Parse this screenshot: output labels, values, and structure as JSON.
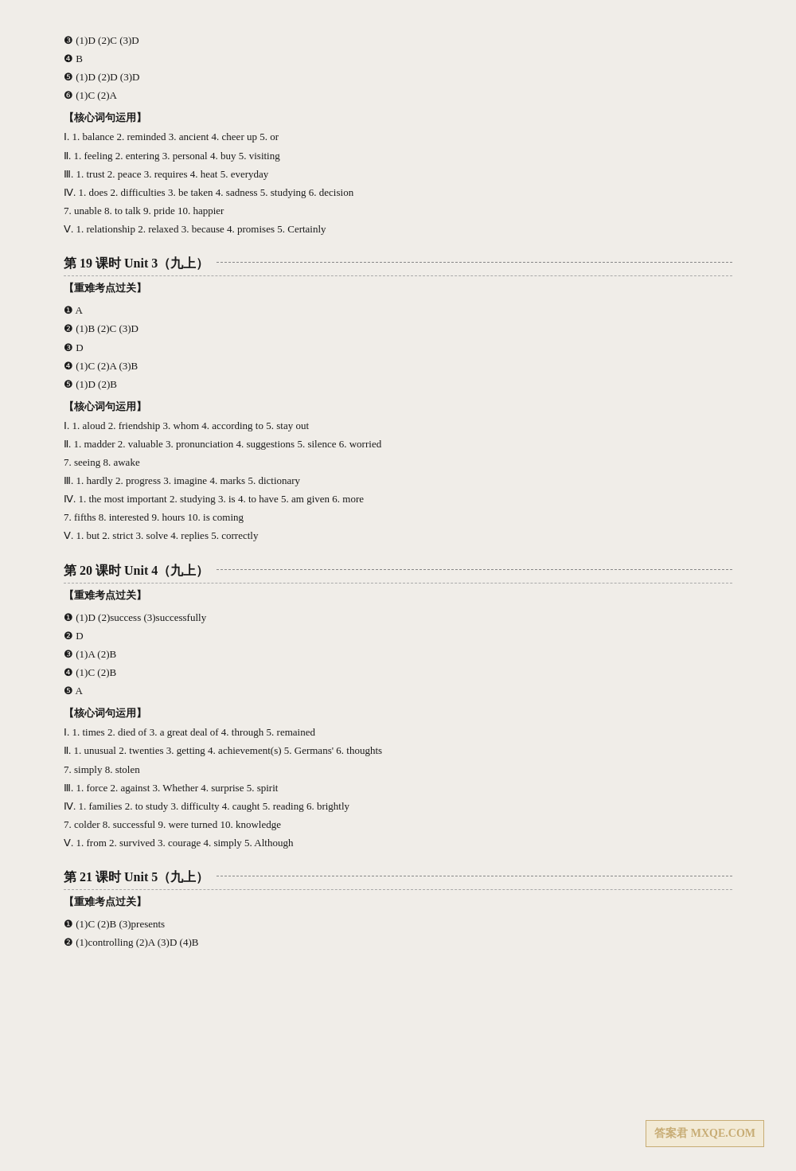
{
  "sections": [
    {
      "type": "answers",
      "lines": [
        "❸ (1)D  (2)C  (3)D",
        "❹ B",
        "❺ (1)D  (2)D  (3)D",
        "❻ (1)C  (2)A"
      ]
    },
    {
      "type": "vocab-section",
      "label": "【核心词句运用】",
      "items": [
        "Ⅰ. 1. balance  2. reminded  3. ancient  4. cheer up  5. or",
        "Ⅱ. 1. feeling  2. entering  3. personal  4. buy  5. visiting",
        "Ⅲ. 1. trust  2. peace  3. requires  4. heat  5. everyday",
        "Ⅳ. 1. does  2. difficulties  3. be taken  4. sadness  5. studying  6. decision",
        "7. unable  8. to talk  9. pride  10. happier",
        "Ⅴ. 1. relationship  2. relaxed  3. because  4. promises  5. Certainly"
      ]
    },
    {
      "type": "unit-header",
      "title": "第 19 课时   Unit 3（九上）"
    },
    {
      "type": "vocab-section",
      "label": "【重难考点过关】",
      "items": []
    },
    {
      "type": "answers",
      "lines": [
        "❶ A",
        "❷ (1)B  (2)C  (3)D",
        "❸ D",
        "❹ (1)C  (2)A  (3)B",
        "❺ (1)D  (2)B"
      ]
    },
    {
      "type": "vocab-section",
      "label": "【核心词句运用】",
      "items": [
        "Ⅰ. 1. aloud  2. friendship  3. whom  4. according to  5. stay out",
        "Ⅱ. 1. madder  2. valuable  3. pronunciation  4. suggestions  5. silence  6. worried",
        "7. seeing  8. awake",
        "Ⅲ. 1. hardly  2. progress  3. imagine  4. marks  5. dictionary",
        "Ⅳ. 1. the most important  2. studying  3. is  4. to have  5. am given  6. more",
        "7. fifths  8. interested  9. hours  10. is coming",
        "Ⅴ. 1. but  2. strict  3. solve  4. replies  5. correctly"
      ]
    },
    {
      "type": "unit-header",
      "title": "第 20 课时   Unit 4（九上）"
    },
    {
      "type": "vocab-section",
      "label": "【重难考点过关】",
      "items": []
    },
    {
      "type": "answers",
      "lines": [
        "❶ (1)D  (2)success  (3)successfully",
        "❷ D",
        "❸ (1)A  (2)B",
        "❹ (1)C  (2)B",
        "❺ A"
      ]
    },
    {
      "type": "vocab-section",
      "label": "【核心词句运用】",
      "items": [
        "Ⅰ. 1. times  2. died of  3. a great deal of  4. through  5. remained",
        "Ⅱ. 1. unusual  2. twenties  3. getting  4. achievement(s)  5. Germans'  6. thoughts",
        "7. simply  8. stolen",
        "Ⅲ. 1. force  2. against  3. Whether  4. surprise  5. spirit",
        "Ⅳ. 1. families  2. to study  3. difficulty  4. caught  5. reading  6. brightly",
        "7. colder  8. successful  9. were turned  10. knowledge",
        "Ⅴ. 1. from  2. survived  3. courage  4. simply  5. Although"
      ]
    },
    {
      "type": "unit-header",
      "title": "第 21 课时   Unit 5（九上）"
    },
    {
      "type": "vocab-section",
      "label": "【重难考点过关】",
      "items": []
    },
    {
      "type": "answers",
      "lines": [
        "❶ (1)C  (2)B  (3)presents",
        "❷ (1)controlling  (2)A  (3)D  (4)B"
      ]
    }
  ],
  "watermark": "答案君  MXQE.COM"
}
